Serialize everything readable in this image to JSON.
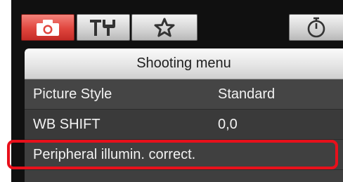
{
  "tabs": [
    {
      "icon": "camera-icon",
      "active": true,
      "color": "#e0463e"
    },
    {
      "icon": "tools-icon",
      "active": false
    },
    {
      "icon": "star-icon",
      "active": false
    },
    {
      "icon": "stopwatch-icon",
      "active": false
    }
  ],
  "menu": {
    "title": "Shooting menu",
    "items": [
      {
        "label": "Picture Style",
        "value": "Standard"
      },
      {
        "label": "WB SHIFT",
        "value": "0,0"
      },
      {
        "label": "Peripheral illumin. correct.",
        "value": ""
      }
    ]
  },
  "highlight": {
    "target_item": "Peripheral illumin. correct.",
    "color": "#e8101b"
  }
}
